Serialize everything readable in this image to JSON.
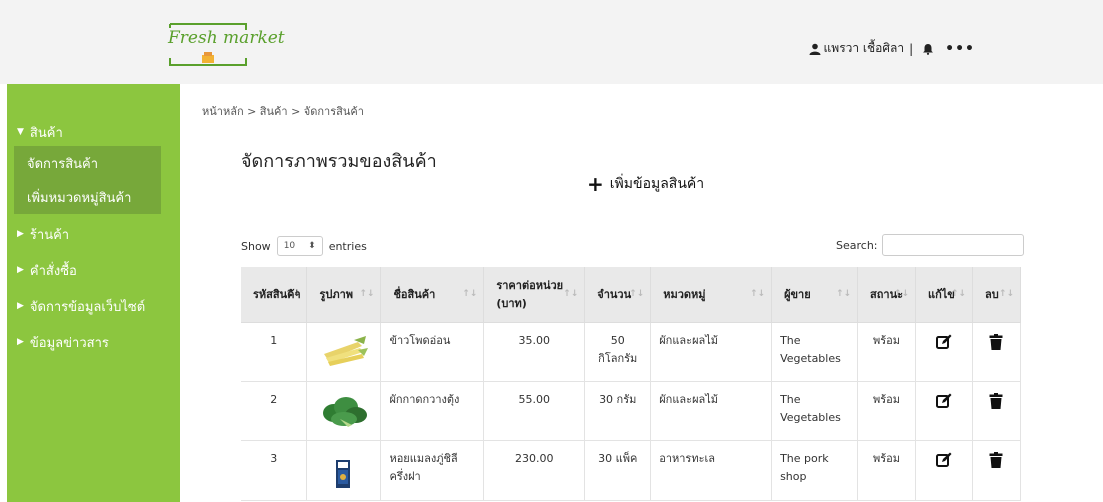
{
  "brand": {
    "logo_text": "Fresh market"
  },
  "header": {
    "user_name": "แพรวา เชื้อศิลา",
    "separator": "|",
    "more": "•••"
  },
  "sidebar": {
    "items": [
      {
        "label": "สินค้า",
        "arrow": "▼"
      },
      {
        "label": "ร้านค้า",
        "arrow": "▶"
      },
      {
        "label": "คำสั่งซื้อ",
        "arrow": "▶"
      },
      {
        "label": "จัดการข้อมูลเว็บไซต์",
        "arrow": "▶"
      },
      {
        "label": "ข้อมูลข่าวสาร",
        "arrow": "▶"
      }
    ],
    "sub_items": [
      {
        "label": "จัดการสินค้า"
      },
      {
        "label": "เพิ่มหมวดหมู่สินค้า"
      }
    ]
  },
  "breadcrumb": "หน้าหลัก > สินค้า > จัดการสินค้า",
  "page": {
    "title": "จัดการภาพรวมของสินค้า",
    "add_label": "เพิ่มข้อมูลสินค้า"
  },
  "table_controls": {
    "show_label": "Show",
    "page_size": "10",
    "entries_label": "entries",
    "search_label": "Search:"
  },
  "table": {
    "headers": [
      "รหัสสินค้า",
      "รูปภาพ",
      "ชื่อสินค้า",
      "ราคาต่อหน่วย (บาท)",
      "จำนวน",
      "หมวดหมู่",
      "ผู้ขาย",
      "สถานะ",
      "แก้ไข",
      "ลบ"
    ],
    "rows": [
      {
        "id": "1",
        "image": "baby-corn",
        "name": "ข้าวโพดอ่อน",
        "price": "35.00",
        "qty": "50 กิโลกรัม",
        "category": "ผักและผลไม้",
        "seller": "The Vegetables",
        "status": "พร้อม"
      },
      {
        "id": "2",
        "image": "chinese-cabbage",
        "name": "ผักกาดกวางตุ้ง",
        "price": "55.00",
        "qty": "30 กรัม",
        "category": "ผักและผลไม้",
        "seller": "The Vegetables",
        "status": "พร้อม"
      },
      {
        "id": "3",
        "image": "packaged-shellfish",
        "name": "หอยแมลงภู่ชิลีครึ่งฝา",
        "price": "230.00",
        "qty": "30 แพ็ค",
        "category": "อาหารทะเล",
        "seller": "The pork shop",
        "status": "พร้อม"
      }
    ]
  },
  "icons": {
    "user": "user-icon",
    "bell": "bell-icon",
    "edit": "edit-icon",
    "delete": "trash-icon",
    "plus": "plus-icon"
  },
  "colors": {
    "sidebar": "#8cc63f",
    "sidebar_active": "#77a83a",
    "header_bg": "#f3f3f3",
    "brand_green": "#5aa02c"
  }
}
